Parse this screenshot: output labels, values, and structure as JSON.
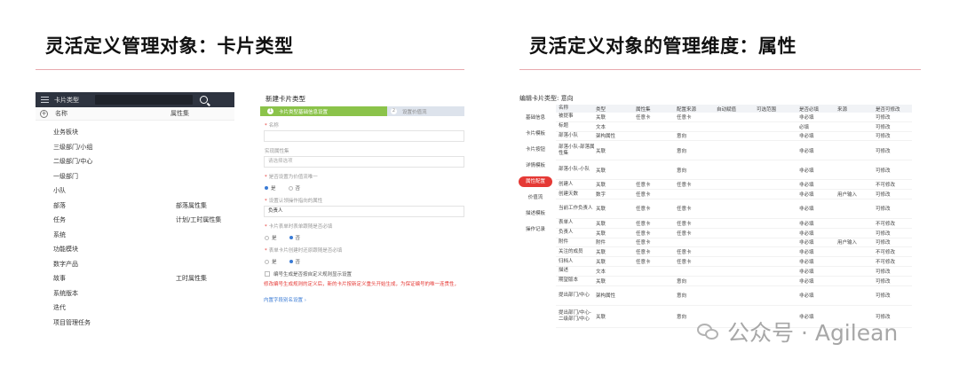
{
  "slide": {
    "title_left": "灵活定义管理对象：卡片类型",
    "title_right": "灵活定义对象的管理维度：属性"
  },
  "card_list": {
    "header_title": "卡片类型",
    "col_name": "名称",
    "col_attr": "属性集",
    "rows": [
      {
        "name": "业务板块",
        "attr": ""
      },
      {
        "name": "三级部门/小组",
        "attr": ""
      },
      {
        "name": "二级部门/中心",
        "attr": ""
      },
      {
        "name": "一级部门",
        "attr": ""
      },
      {
        "name": "小队",
        "attr": ""
      },
      {
        "name": "部落",
        "attr": "部落属性集"
      },
      {
        "name": "任务",
        "attr": "计划/工时属性集"
      },
      {
        "name": "系统",
        "attr": ""
      },
      {
        "name": "功能模块",
        "attr": ""
      },
      {
        "name": "数字产品",
        "attr": ""
      },
      {
        "name": "故事",
        "attr": "工时属性集"
      },
      {
        "name": "系统版本",
        "attr": ""
      },
      {
        "name": "迭代",
        "attr": ""
      },
      {
        "name": "项目管理任务",
        "attr": ""
      }
    ]
  },
  "new_card": {
    "title": "新建卡片类型",
    "step1_num": "1",
    "step1": "卡片类型基础信息设置",
    "step2_num": "2",
    "step2": "设置价值流",
    "name_label": "名称",
    "attrset_label": "实现属性集",
    "attrset_placeholder": "请选择选项",
    "unique_label": "是否设置为价值流唯一",
    "unique_yes": "是",
    "unique_no": "否",
    "owner_label": "设置认领操作指向的属性",
    "owner_value": "负责人",
    "q3_label": "卡片表单时表单跟随是否必填",
    "q3_yes": "是",
    "q3_no": "否",
    "q4_label": "表单卡片创建时还原跟随是否必填",
    "q4_yes": "是",
    "q4_no": "否",
    "check_label": "编号生成是否按自定义规则显示设置",
    "warn": "修改编号生成规则的定义后，新的卡片按新定义重头开始生成，为保证编号的唯一连贯性，",
    "link": "内置字段别名设置 ›"
  },
  "edit_card": {
    "title": "编辑卡片类型: 意向",
    "nav": [
      "基础信息",
      "卡片模板",
      "卡片按钮",
      "详情模板",
      "属性配置",
      "价值流",
      "描述模板",
      "操作记录"
    ],
    "nav_active_index": 4,
    "columns": [
      "名称",
      "类型",
      "属性集",
      "配置来源",
      "自动赋值",
      "可选范围",
      "是否必填",
      "来源",
      "是否可修改"
    ],
    "rows": [
      [
        "被提事",
        "关联",
        "任意卡",
        "任意卡",
        "",
        "",
        "非必填",
        "",
        "可修改"
      ],
      [
        "标题",
        "文本",
        "",
        "",
        "",
        "",
        "必填",
        "",
        "可修改"
      ],
      [
        "部落小队",
        "架构属性",
        "",
        "意向",
        "",
        "",
        "非必填",
        "",
        "可修改"
      ],
      [
        "部落小队-部落属性集",
        "关联",
        "",
        "意向",
        "",
        "",
        "非必填",
        "",
        "可修改"
      ],
      [
        "部落小队-小队",
        "关联",
        "",
        "意向",
        "",
        "",
        "非必填",
        "",
        "可修改"
      ],
      [
        "创建人",
        "关联",
        "任意卡",
        "任意卡",
        "",
        "",
        "非必填",
        "",
        "不可修改"
      ],
      [
        "创建天数",
        "数字",
        "任意卡",
        "",
        "",
        "",
        "非必填",
        "用户输入",
        "可修改"
      ],
      [
        "当前工作负责人",
        "关联",
        "任意卡",
        "任意卡",
        "",
        "",
        "非必填",
        "",
        "可修改"
      ],
      [
        "表单人",
        "关联",
        "任意卡",
        "任意卡",
        "",
        "",
        "非必填",
        "",
        "不可修改"
      ],
      [
        "负责人",
        "关联",
        "任意卡",
        "任意卡",
        "",
        "",
        "非必填",
        "",
        "可修改"
      ],
      [
        "附件",
        "附件",
        "任意卡",
        "",
        "",
        "",
        "非必填",
        "用户输入",
        "可修改"
      ],
      [
        "关注的成员",
        "关联",
        "任意卡",
        "任意卡",
        "",
        "",
        "非必填",
        "",
        "不可修改"
      ],
      [
        "归档人",
        "关联",
        "任意卡",
        "任意卡",
        "",
        "",
        "非必填",
        "",
        "不可修改"
      ],
      [
        "描述",
        "文本",
        "",
        "",
        "",
        "",
        "非必填",
        "",
        "可修改"
      ],
      [
        "期望版本",
        "关联",
        "",
        "意向",
        "",
        "",
        "非必填",
        "",
        "可修改"
      ],
      [
        "提出部门/中心",
        "架构属性",
        "",
        "意向",
        "",
        "",
        "非必填",
        "",
        "可修改"
      ],
      [
        "提出部门/中心-二级部门/中心",
        "关联",
        "",
        "意向",
        "",
        "",
        "非必填",
        "",
        "可修改"
      ]
    ]
  },
  "watermark": {
    "icon": "wechat-icon",
    "text": "公众号 · Agilean"
  }
}
